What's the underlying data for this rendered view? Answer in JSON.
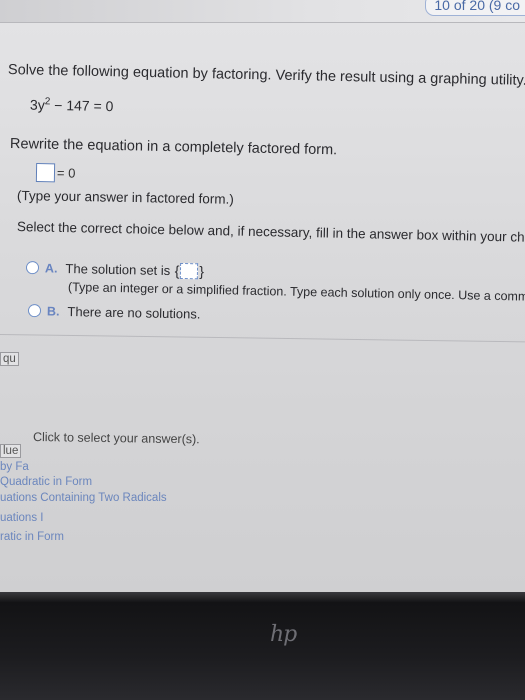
{
  "header": {
    "page_counter": "10 of 20 (9 co"
  },
  "question": {
    "prompt": "Solve the following equation by factoring. Verify the result using a graphing utility.",
    "equation_base": "3y",
    "equation_exp": "2",
    "equation_rest": " − 147 = 0",
    "rewrite_instruction": "Rewrite the equation in a completely factored form.",
    "factored_suffix": "= 0",
    "factored_hint": "(Type your answer in factored form.)",
    "select_instruction": "Select the correct choice below and, if necessary, fill in the answer box within your choice."
  },
  "choices": [
    {
      "letter": "A.",
      "text": "The solution set is",
      "open_brace": "{",
      "close_brace": "}",
      "hint": "(Type an integer or a simplified fraction. Type each solution only once. Use a comma t"
    },
    {
      "letter": "B.",
      "text": "There are no solutions."
    }
  ],
  "footer": {
    "click_to_select": "Click to select your answer(s)."
  },
  "sidebar": {
    "items": [
      "qu",
      "lue",
      "by Fa",
      "Quadratic in Form",
      "uations Containing Two Radicals",
      "uations I",
      "ratic in Form"
    ]
  },
  "device": {
    "logo": "hp"
  }
}
